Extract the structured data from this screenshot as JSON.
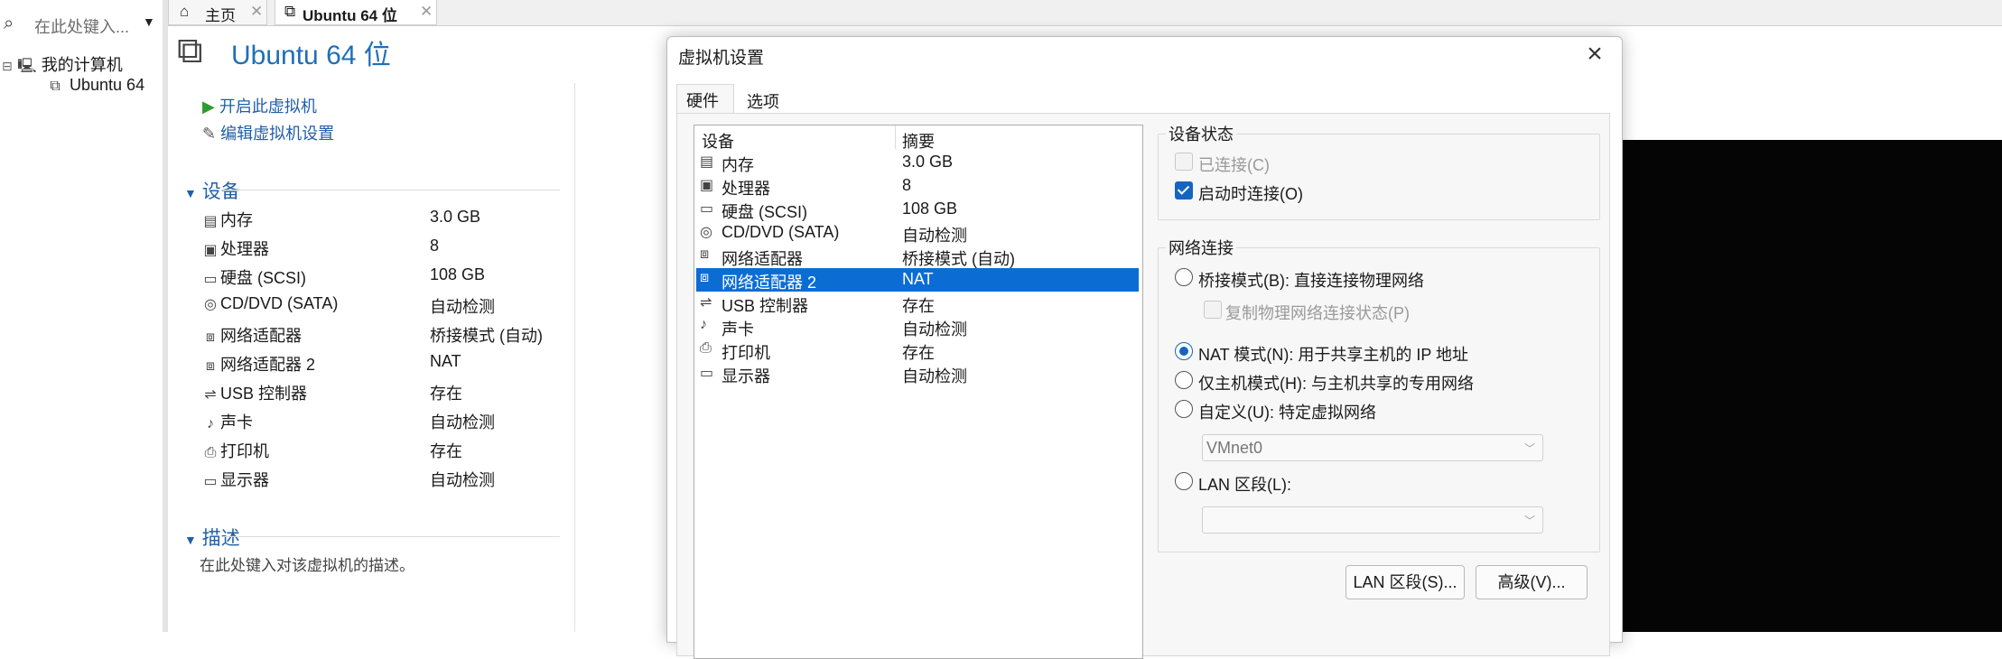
{
  "sidebar": {
    "search_placeholder": "在此处键入...",
    "tree": {
      "root": "我的计算机",
      "child": "Ubuntu 64"
    }
  },
  "tabs": [
    {
      "label": "主页"
    },
    {
      "label": "Ubuntu 64 位"
    }
  ],
  "vm": {
    "title": "Ubuntu 64 位",
    "commands": {
      "start": "开启此虚拟机",
      "edit": "编辑虚拟机设置"
    },
    "devices_header": "设备",
    "devices": [
      {
        "icon": "memory-icon",
        "name": "内存",
        "value": "3.0 GB"
      },
      {
        "icon": "cpu-icon",
        "name": "处理器",
        "value": "8"
      },
      {
        "icon": "disk-icon",
        "name": "硬盘 (SCSI)",
        "value": "108 GB"
      },
      {
        "icon": "cd-icon",
        "name": "CD/DVD (SATA)",
        "value": "自动检测"
      },
      {
        "icon": "network-icon",
        "name": "网络适配器",
        "value": "桥接模式 (自动)"
      },
      {
        "icon": "network-icon",
        "name": "网络适配器 2",
        "value": "NAT"
      },
      {
        "icon": "usb-icon",
        "name": "USB 控制器",
        "value": "存在"
      },
      {
        "icon": "sound-icon",
        "name": "声卡",
        "value": "自动检测"
      },
      {
        "icon": "printer-icon",
        "name": "打印机",
        "value": "存在"
      },
      {
        "icon": "display-icon",
        "name": "显示器",
        "value": "自动检测"
      }
    ],
    "desc_header": "描述",
    "desc_placeholder": "在此处键入对该虚拟机的描述。"
  },
  "dialog": {
    "title": "虚拟机设置",
    "tabs": {
      "hardware": "硬件",
      "options": "选项"
    },
    "list_headers": {
      "device": "设备",
      "summary": "摘要"
    },
    "list": [
      {
        "name": "内存",
        "summary": "3.0 GB"
      },
      {
        "name": "处理器",
        "summary": "8"
      },
      {
        "name": "硬盘 (SCSI)",
        "summary": "108 GB"
      },
      {
        "name": "CD/DVD (SATA)",
        "summary": "自动检测"
      },
      {
        "name": "网络适配器",
        "summary": "桥接模式 (自动)"
      },
      {
        "name": "网络适配器 2",
        "summary": "NAT"
      },
      {
        "name": "USB 控制器",
        "summary": "存在"
      },
      {
        "name": "声卡",
        "summary": "自动检测"
      },
      {
        "name": "打印机",
        "summary": "存在"
      },
      {
        "name": "显示器",
        "summary": "自动检测"
      }
    ],
    "selected_index": 5,
    "device_status": {
      "legend": "设备状态",
      "connected": {
        "label": "已连接(C)",
        "checked": false,
        "enabled": false
      },
      "connect_on_start": {
        "label": "启动时连接(O)",
        "checked": true
      }
    },
    "network": {
      "legend": "网络连接",
      "bridged": {
        "label": "桥接模式(B): 直接连接物理网络",
        "selected": false
      },
      "replicate": {
        "label": "复制物理网络连接状态(P)",
        "checked": false,
        "enabled": false
      },
      "nat": {
        "label": "NAT 模式(N): 用于共享主机的 IP 地址",
        "selected": true
      },
      "host_only": {
        "label": "仅主机模式(H): 与主机共享的专用网络",
        "selected": false
      },
      "custom": {
        "label": "自定义(U): 特定虚拟网络",
        "selected": false
      },
      "custom_select": "VMnet0",
      "lan": {
        "label": "LAN 区段(L):",
        "selected": false
      },
      "lan_select": ""
    },
    "buttons": {
      "lan_segments": "LAN 区段(S)...",
      "advanced": "高级(V)..."
    }
  },
  "colors": {
    "accent": "#1f6fb6",
    "selection": "#0b6dd4"
  }
}
